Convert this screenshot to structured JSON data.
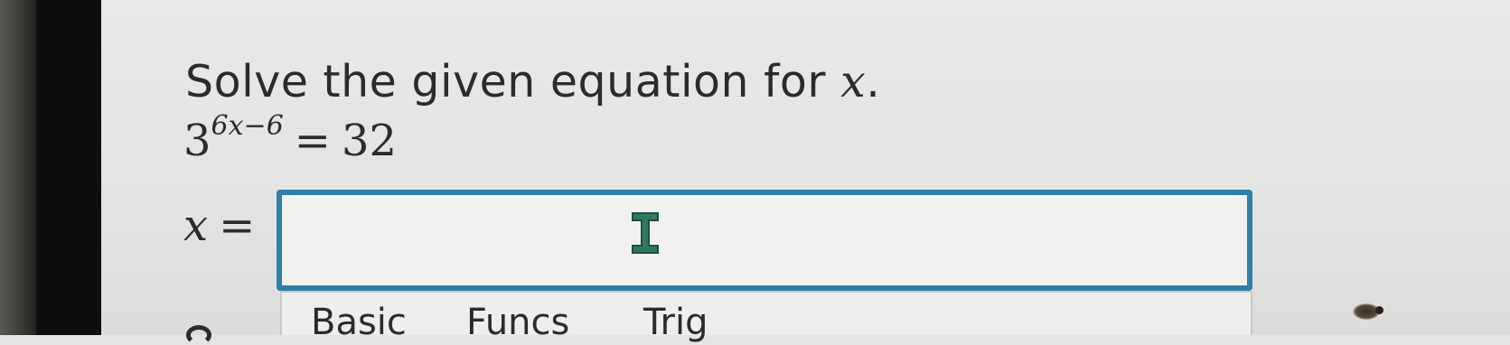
{
  "question": {
    "prompt_text": "Solve the given equation for ",
    "prompt_var": "x",
    "prompt_end": "."
  },
  "equation": {
    "base": "3",
    "exponent": "6x−6",
    "equals": "=",
    "rhs": "32"
  },
  "answer": {
    "label_var": "x",
    "label_equals": "=",
    "value": "",
    "placeholder": ""
  },
  "tabs": [
    {
      "label": "Basic"
    },
    {
      "label": "Funcs"
    },
    {
      "label": "Trig"
    }
  ],
  "icons": {
    "cursor": "text-cursor-icon"
  },
  "colors": {
    "input_border": "#2f7fa8",
    "cursor_fill": "#2e7a5e"
  }
}
